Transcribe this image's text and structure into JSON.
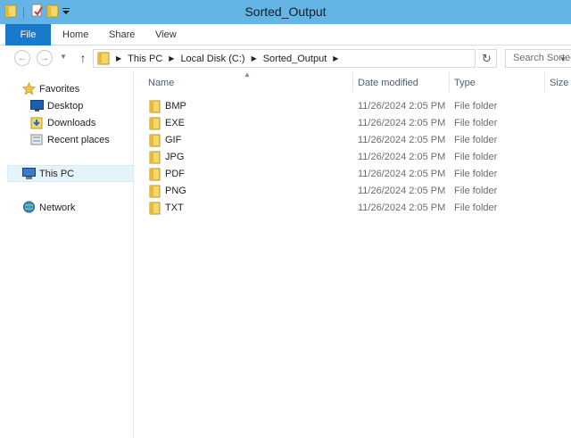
{
  "window": {
    "title": "Sorted_Output"
  },
  "ribbon": {
    "file": "File",
    "tabs": [
      "Home",
      "Share",
      "View"
    ]
  },
  "address": {
    "crumbs": [
      "This PC",
      "Local Disk (C:)",
      "Sorted_Output"
    ],
    "search_placeholder": "Search Sorted_Output"
  },
  "nav": {
    "favorites": "Favorites",
    "desktop": "Desktop",
    "downloads": "Downloads",
    "recent": "Recent places",
    "this_pc": "This PC",
    "network": "Network"
  },
  "columns": {
    "name": "Name",
    "date": "Date modified",
    "type": "Type",
    "size": "Size"
  },
  "files": [
    {
      "name": "BMP",
      "date": "11/26/2024 2:05 PM",
      "type": "File folder"
    },
    {
      "name": "EXE",
      "date": "11/26/2024 2:05 PM",
      "type": "File folder"
    },
    {
      "name": "GIF",
      "date": "11/26/2024 2:05 PM",
      "type": "File folder"
    },
    {
      "name": "JPG",
      "date": "11/26/2024 2:05 PM",
      "type": "File folder"
    },
    {
      "name": "PDF",
      "date": "11/26/2024 2:05 PM",
      "type": "File folder"
    },
    {
      "name": "PNG",
      "date": "11/26/2024 2:05 PM",
      "type": "File folder"
    },
    {
      "name": "TXT",
      "date": "11/26/2024 2:05 PM",
      "type": "File folder"
    }
  ],
  "colors": {
    "titlebar": "#64b4e6",
    "file_tab": "#1979ca",
    "header_text": "#4c607a"
  }
}
